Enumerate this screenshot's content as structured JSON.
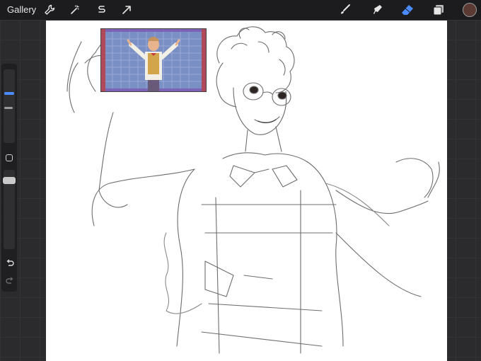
{
  "topbar": {
    "gallery_label": "Gallery",
    "left_tools": [
      "wrench-icon",
      "magic-wand-icon",
      "selection-icon",
      "transform-arrow-icon"
    ],
    "right_tools": [
      "brush-icon",
      "smudge-icon",
      "eraser-icon",
      "layers-icon"
    ],
    "active_tool": "eraser",
    "active_color": "#5a3a32",
    "accent_color": "#4a8cff"
  },
  "sidebar": {
    "size_slider_value": 0.25,
    "opacity_slider_value": 0.9,
    "undo_icon": "undo-icon",
    "redo_icon": "redo-icon"
  }
}
